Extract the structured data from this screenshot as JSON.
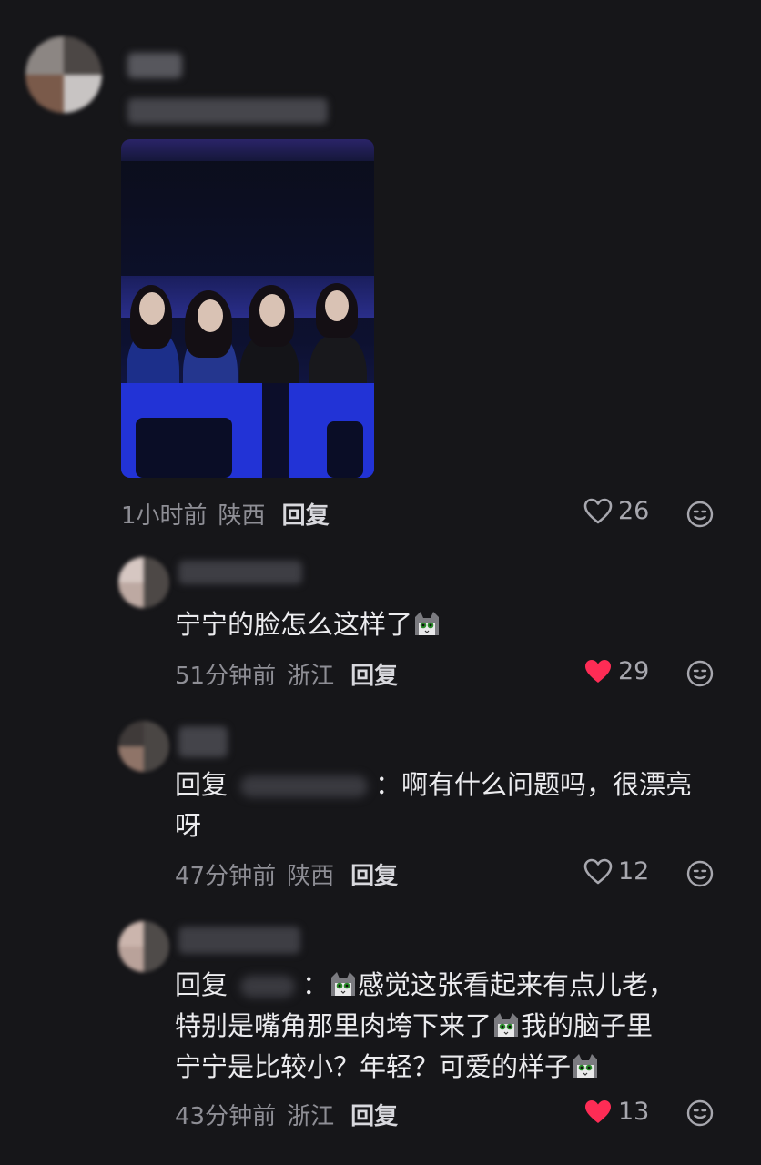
{
  "comments": [
    {
      "time": "1小时前",
      "location": "陕西",
      "reply_label": "回复",
      "likes": "26",
      "liked": false
    },
    {
      "text": "宁宁的脸怎么这样了",
      "time": "51分钟前",
      "location": "浙江",
      "reply_label": "回复",
      "likes": "29",
      "liked": true
    },
    {
      "prefix": "回复",
      "colon": "：",
      "line1": "啊有什么问题吗，很漂亮",
      "line2": "呀",
      "time": "47分钟前",
      "location": "陕西",
      "reply_label": "回复",
      "likes": "12",
      "liked": false
    },
    {
      "prefix": "回复",
      "colon": "：",
      "line1": "感觉这张看起来有点儿老，",
      "line2a": "特别是嘴角那里肉垮下来了",
      "line2b": "我的脑子里",
      "line3": "宁宁是比较小？年轻？可爱的样子",
      "time": "43分钟前",
      "location": "浙江",
      "reply_label": "回复",
      "likes": "13",
      "liked": true
    }
  ],
  "icons": {
    "like": "heart-icon",
    "emoji": "smiley-icon",
    "sticker": "cat-emoji"
  },
  "colors": {
    "background": "#161619",
    "liked_heart": "#fe2c55",
    "meta_text": "#8e8e95"
  }
}
